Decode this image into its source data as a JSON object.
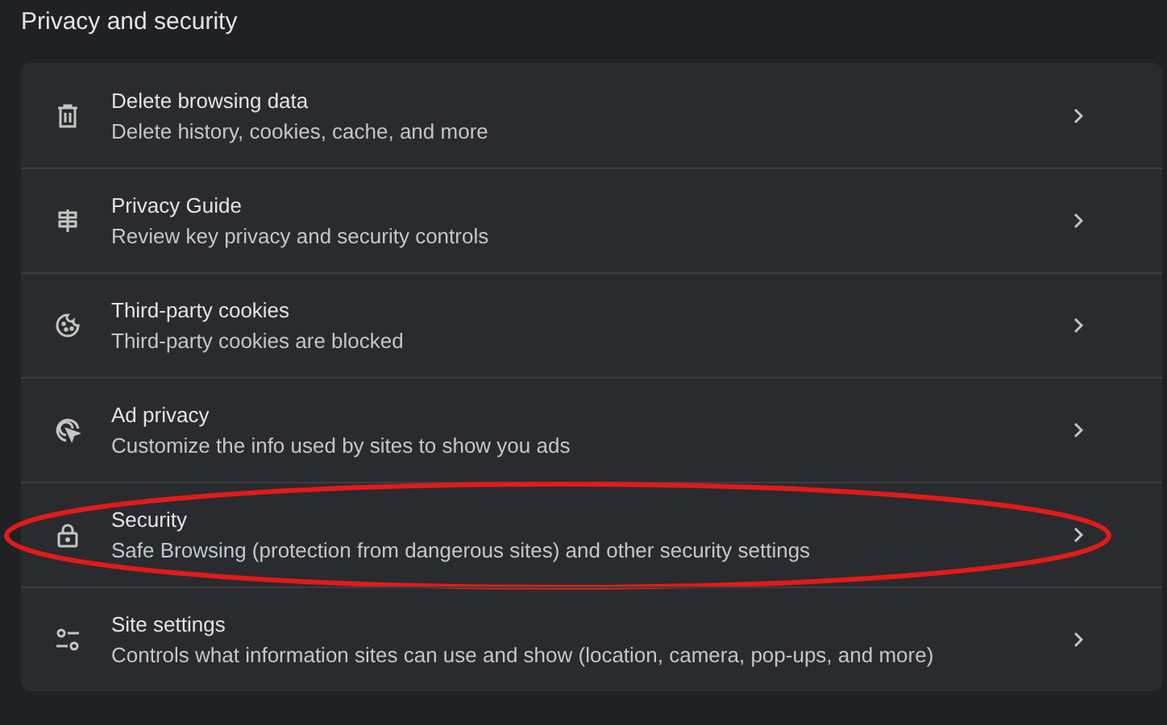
{
  "section": {
    "title": "Privacy and security"
  },
  "items": [
    {
      "title": "Delete browsing data",
      "subtitle": "Delete history, cookies, cache, and more",
      "highlighted": false
    },
    {
      "title": "Privacy Guide",
      "subtitle": "Review key privacy and security controls",
      "highlighted": false
    },
    {
      "title": "Third-party cookies",
      "subtitle": "Third-party cookies are blocked",
      "highlighted": false
    },
    {
      "title": "Ad privacy",
      "subtitle": "Customize the info used by sites to show you ads",
      "highlighted": false
    },
    {
      "title": "Security",
      "subtitle": "Safe Browsing (protection from dangerous sites) and other security settings",
      "highlighted": true
    },
    {
      "title": "Site settings",
      "subtitle": "Controls what information sites can use and show (location, camera, pop-ups, and more)",
      "highlighted": false
    }
  ]
}
